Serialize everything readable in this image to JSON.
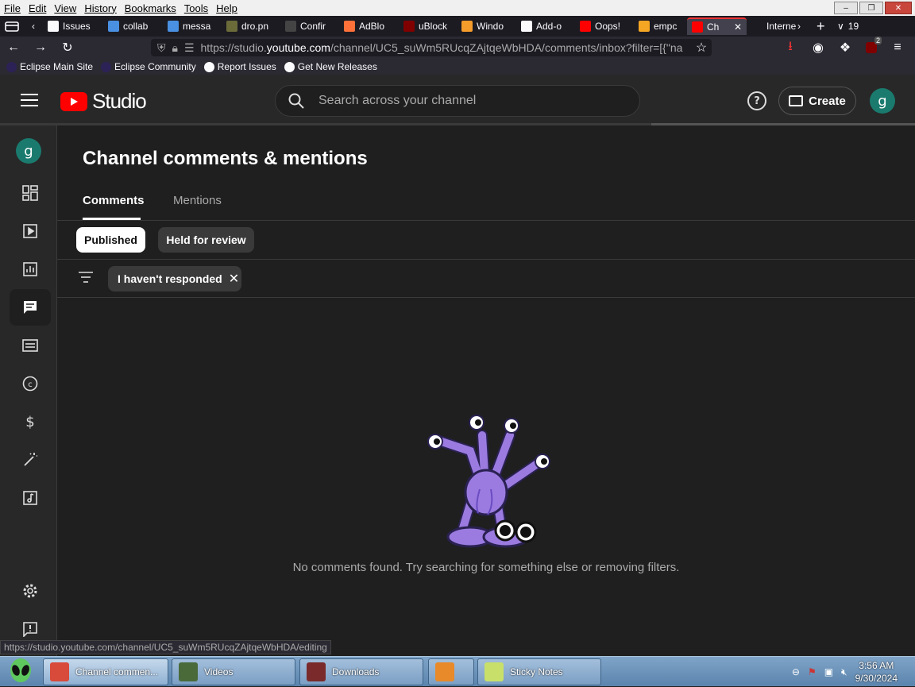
{
  "menubar": {
    "items": [
      "File",
      "Edit",
      "View",
      "History",
      "Bookmarks",
      "Tools",
      "Help"
    ]
  },
  "tabs": [
    {
      "label": "Issues",
      "icon": "github-icon",
      "color": "#fbfbfe"
    },
    {
      "label": "collab",
      "icon": "doc-icon",
      "color": "#4a90e2"
    },
    {
      "label": "messa",
      "icon": "doc-icon",
      "color": "#4a90e2"
    },
    {
      "label": "dro.pn",
      "icon": "image-icon",
      "color": "#6b6b3a"
    },
    {
      "label": "Confir",
      "icon": "b-icon",
      "color": "#444"
    },
    {
      "label": "AdBlo",
      "icon": "firefox-icon",
      "color": "#ff7139"
    },
    {
      "label": "uBlock",
      "icon": "ublock-icon",
      "color": "#800000"
    },
    {
      "label": "Windo",
      "icon": "diamond-icon",
      "color": "#f59c2b"
    },
    {
      "label": "Add-o",
      "icon": "puzzle-icon",
      "color": "#fbfbfe"
    },
    {
      "label": "Oops!",
      "icon": "youtube-icon",
      "color": "#ff0000"
    },
    {
      "label": "empc",
      "icon": "mail-icon",
      "color": "#f5a623"
    },
    {
      "label": "Ch",
      "icon": "youtube-icon",
      "color": "#ff0000",
      "active": true
    },
    {
      "label": "Interne",
      "icon": "none",
      "color": "#1c1b22"
    }
  ],
  "tab_count": "19",
  "url": {
    "prefix": "https://studio.",
    "domain": "youtube.com",
    "rest": "/channel/UC5_suWm5RUcqZAjtqeWbHDA/comments/inbox?filter=[{\"na"
  },
  "ublock_badge": "2",
  "bookmarks": [
    {
      "label": "Eclipse Main Site",
      "color": "#2c2255"
    },
    {
      "label": "Eclipse Community",
      "color": "#2c2255"
    },
    {
      "label": "Report Issues",
      "color": "#fbfbfe"
    },
    {
      "label": "Get New Releases",
      "color": "#fbfbfe"
    }
  ],
  "studio": {
    "logo_text": "Studio",
    "search_placeholder": "Search across your channel",
    "create_label": "Create",
    "avatar_letter": "g"
  },
  "sidebar": {
    "avatar_letter": "g",
    "items": [
      {
        "name": "dashboard",
        "icon": "dashboard-icon"
      },
      {
        "name": "content",
        "icon": "video-icon"
      },
      {
        "name": "analytics",
        "icon": "analytics-icon"
      },
      {
        "name": "comments",
        "icon": "comment-icon",
        "active": true
      },
      {
        "name": "subtitles",
        "icon": "subtitles-icon"
      },
      {
        "name": "copyright",
        "icon": "copyright-icon"
      },
      {
        "name": "earn",
        "icon": "dollar-icon"
      },
      {
        "name": "customization",
        "icon": "magic-wand-icon"
      },
      {
        "name": "audio-library",
        "icon": "music-icon"
      },
      {
        "name": "settings",
        "icon": "gear-icon"
      },
      {
        "name": "feedback",
        "icon": "feedback-icon"
      }
    ]
  },
  "main": {
    "title": "Channel comments & mentions",
    "tabs": [
      {
        "label": "Comments",
        "active": true
      },
      {
        "label": "Mentions"
      }
    ],
    "chips": [
      {
        "label": "Published",
        "selected": true
      },
      {
        "label": "Held for review"
      }
    ],
    "filter_chip": "I haven't responded",
    "empty_message": "No comments found. Try searching for something else or removing filters."
  },
  "status_url": "https://studio.youtube.com/channel/UC5_suWm5RUcqZAjtqeWbHDA/editing",
  "taskbar": {
    "items": [
      {
        "label": "Channel commen...",
        "icon_color": "#d84a3a"
      },
      {
        "label": "Videos",
        "icon_color": "#4a6a3a"
      },
      {
        "label": "Downloads",
        "icon_color": "#7a2a2a"
      },
      {
        "label": "",
        "icon_color": "#e88a2a"
      },
      {
        "label": "Sticky Notes",
        "icon_color": "#c8e06a"
      }
    ],
    "time": "3:56 AM",
    "date": "9/30/2024"
  }
}
